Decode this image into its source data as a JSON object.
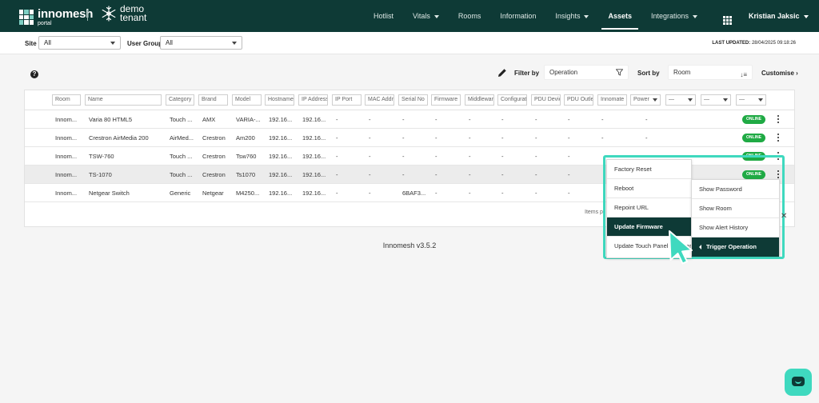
{
  "brand": {
    "name": "innomesh",
    "sub": "portal",
    "tenant_line1": "demo",
    "tenant_line2": "tenant"
  },
  "nav": {
    "items": [
      {
        "label": "Hotlist",
        "dropdown": false,
        "active": false
      },
      {
        "label": "Vitals",
        "dropdown": true,
        "active": false
      },
      {
        "label": "Rooms",
        "dropdown": false,
        "active": false
      },
      {
        "label": "Information",
        "dropdown": false,
        "active": false
      },
      {
        "label": "Insights",
        "dropdown": true,
        "active": false
      },
      {
        "label": "Assets",
        "dropdown": false,
        "active": true
      },
      {
        "label": "Integrations",
        "dropdown": true,
        "active": false
      }
    ],
    "user": "Kristian Jaksic"
  },
  "filters": {
    "site_label": "Site",
    "site_value": "All",
    "group_label": "User Group",
    "group_value": "All",
    "last_updated_label": "LAST UPDATED:",
    "last_updated_value": "28/04/2025 09:18:26"
  },
  "toolbar": {
    "filter_label": "Filter by",
    "filter_value": "Operation",
    "sort_label": "Sort by",
    "sort_value": "Room",
    "customise": "Customise"
  },
  "table": {
    "columns": [
      "Room",
      "Name",
      "Category",
      "Brand",
      "Model",
      "Hostname",
      "IP Address",
      "IP Port",
      "MAC Address",
      "Serial No",
      "Firmware",
      "Middleware",
      "Configuration",
      "PDU Device",
      "PDU Outlet",
      "Innomate",
      "Power",
      "—",
      "—",
      "—"
    ],
    "rows": [
      {
        "cells": [
          "Innom...",
          "Varia 80 HTML5",
          "Touch ...",
          "AMX",
          "VARIA-...",
          "192.16...",
          "192.16...",
          "-",
          "-",
          "-",
          "-",
          "-",
          "-",
          "-",
          "-",
          "-",
          "-"
        ],
        "status": "ONLINE"
      },
      {
        "cells": [
          "Innom...",
          "Crestron AirMedia 200",
          "AirMed...",
          "Crestron",
          "Am200",
          "192.16...",
          "192.16...",
          "-",
          "-",
          "-",
          "-",
          "-",
          "-",
          "-",
          "-",
          "-",
          "-"
        ],
        "status": "ONLINE"
      },
      {
        "cells": [
          "Innom...",
          "TSW-760",
          "Touch ...",
          "Crestron",
          "Tsw760",
          "192.16...",
          "192.16...",
          "-",
          "-",
          "-",
          "-",
          "-",
          "-",
          "-",
          "-",
          "",
          ""
        ],
        "status": "ONLINE"
      },
      {
        "cells": [
          "Innom...",
          "TS-1070",
          "Touch ...",
          "Crestron",
          "Ts1070",
          "192.16...",
          "192.16...",
          "-",
          "-",
          "-",
          "-",
          "-",
          "-",
          "-",
          "-",
          "",
          ""
        ],
        "status": "ONLINE"
      },
      {
        "cells": [
          "Innom...",
          "Netgear Switch",
          "Generic",
          "Netgear",
          "M4250...",
          "192.16...",
          "192.16...",
          "-",
          "-",
          "6BAF3...",
          "-",
          "-",
          "-",
          "-",
          "-",
          "",
          ""
        ],
        "status": ""
      }
    ],
    "footer_text": "Items p"
  },
  "menu_primary": [
    "Factory Reset",
    "Reboot",
    "Repoint URL",
    "Update Firmware",
    "Update Touch Panel Firmware"
  ],
  "menu_secondary": [
    "Show Password",
    "Show Room",
    "Show Alert History",
    "Trigger Operation"
  ],
  "version": "Innomesh v3.5.2",
  "colors": {
    "nav_bg": "#0e3a36",
    "accent": "#3fd9bf",
    "online": "#1faa44"
  }
}
